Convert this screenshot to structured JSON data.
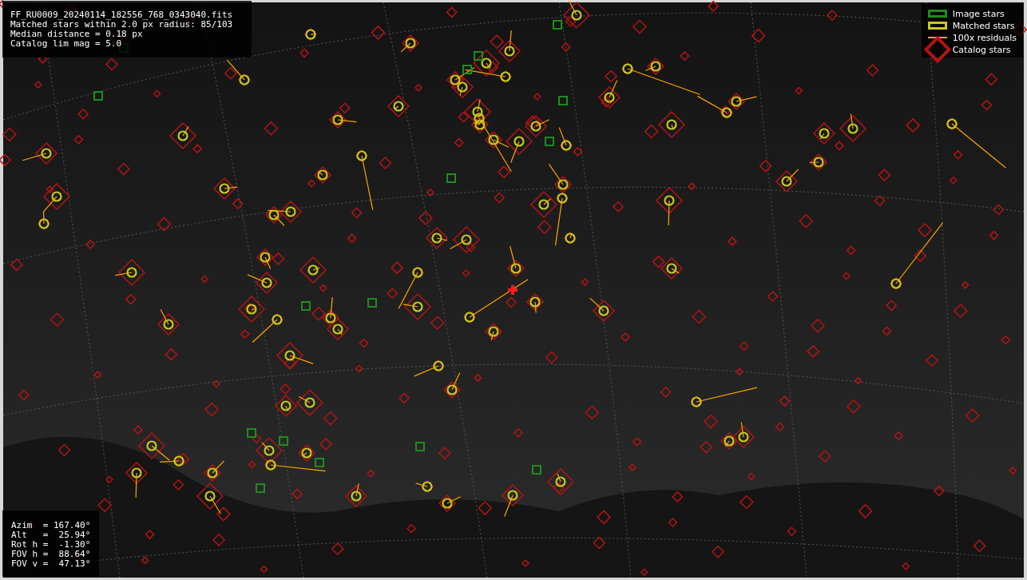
{
  "info_panel": {
    "lines": [
      "FF_RU0009_20240114_182556_768_0343040.fits",
      "Matched stars within 2.0 px radius: 85/103",
      "Median distance = 0.18 px",
      "Catalog lim mag = 5.0"
    ]
  },
  "legend": [
    {
      "kind": "image",
      "label": "Image stars",
      "color": "#1e8c1e"
    },
    {
      "kind": "matched",
      "label": "Matched stars",
      "color": "#c8c81e"
    },
    {
      "kind": "residual",
      "label": "100x residuals",
      "color": "#ffa500"
    },
    {
      "kind": "catalog",
      "label": "Catalog stars",
      "color": "#b41414"
    }
  ],
  "pointing_panel": {
    "lines": [
      "Azim  = 167.40°",
      "Alt   =  25.94°",
      "Rot h =  -1.30°",
      "FOV h =  88.64°",
      "FOV v =  47.13°"
    ]
  }
}
